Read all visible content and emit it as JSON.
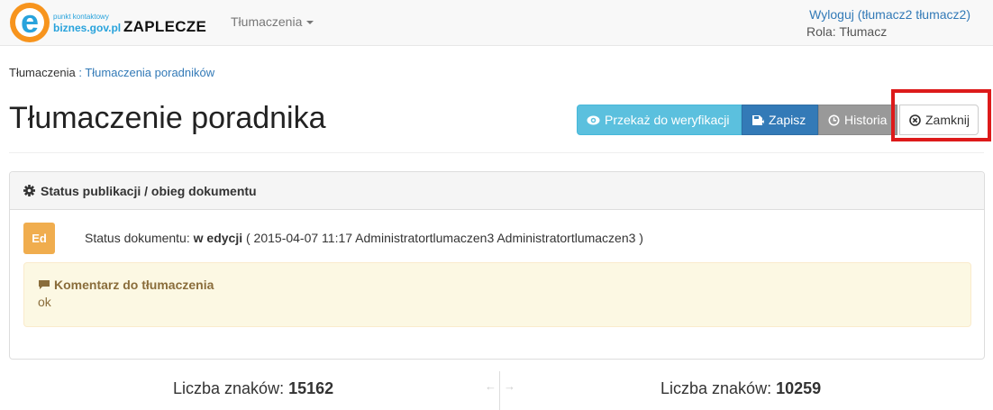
{
  "navbar": {
    "logo_line1": "punkt kontaktowy",
    "logo_line2": "biznes.gov.pl",
    "brand": "ZAPLECZE",
    "menu_label": "Tłumaczenia",
    "logout_label": "Wyloguj (tłumacz2 tłumacz2)",
    "role_label": "Rola: Tłumacz"
  },
  "breadcrumb": {
    "root": "Tłumaczenia",
    "separator": ":",
    "current": "Tłumaczenia poradników"
  },
  "page_title": "Tłumaczenie poradnika",
  "toolbar": {
    "verify_label": "Przekaż do weryfikacji",
    "save_label": "Zapisz",
    "history_label": "Historia",
    "close_label": "Zamknij"
  },
  "status_panel": {
    "heading": "Status publikacji / obieg dokumentu",
    "badge": "Ed",
    "status_prefix": "Status dokumentu:",
    "status_value": "w edycji",
    "status_details": "( 2015-04-07 11:17 Administratortlumaczen3 Administratortlumaczen3 )",
    "comment_title": "Komentarz do tłumaczenia",
    "comment_text": "ok"
  },
  "counters": {
    "left_label": "Liczba znaków:",
    "left_value": "15162",
    "right_label": "Liczba znaków:",
    "right_value": "10259"
  },
  "colors": {
    "info": "#5bc0de",
    "primary": "#337ab7",
    "history": "#999999",
    "highlight": "#dd1a1a",
    "warning": "#f0ad4e",
    "comment_bg": "#fcf8e3"
  },
  "icons": [
    "eye-icon",
    "save-icon",
    "clock-icon",
    "close-circle-icon",
    "gear-icon",
    "comment-icon",
    "arrow-left-icon",
    "arrow-right-icon"
  ]
}
